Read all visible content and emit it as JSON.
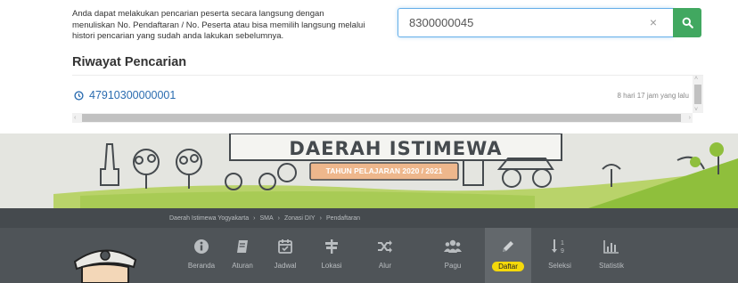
{
  "search": {
    "description": "Anda dapat melakukan pencarian peserta secara langsung dengan menuliskan No. Pendaftaran / No. Peserta atau bisa memilih langsung melalui histori pencarian yang sudah anda lakukan sebelumnya.",
    "value": "8300000045",
    "clear_icon": "×"
  },
  "history": {
    "title": "Riwayat Pencarian",
    "items": [
      {
        "number": "47910300000001",
        "time": "8 hari 17 jam yang lalu"
      }
    ]
  },
  "banner": {
    "region": "DAERAH ISTIMEWA YOGYAKARTA",
    "year": "TAHUN PELAJARAN 2020 / 2021"
  },
  "breadcrumb": {
    "items": [
      "Daerah Istimewa Yogyakarta",
      "SMA",
      "Zonasi DIY",
      "Pendaftaran"
    ],
    "separator": "›"
  },
  "menu": {
    "items": [
      {
        "label": "Beranda",
        "icon": "info-icon"
      },
      {
        "label": "Aturan",
        "icon": "book-icon"
      },
      {
        "label": "Jadwal",
        "icon": "calendar-icon"
      },
      {
        "label": "Lokasi",
        "icon": "signpost-icon"
      },
      {
        "label": "Alur",
        "icon": "shuffle-icon"
      },
      {
        "label": "Pagu",
        "icon": "users-icon"
      },
      {
        "label": "Daftar",
        "icon": "pencil-icon"
      },
      {
        "label": "Seleksi",
        "icon": "sort-numeric-icon"
      },
      {
        "label": "Statistik",
        "icon": "bar-chart-icon"
      }
    ],
    "active": "Daftar"
  },
  "colors": {
    "search_button": "#41a860",
    "link": "#2b6cb0",
    "menu_bg": "#4f5458",
    "active_badge": "#f5d90a"
  }
}
